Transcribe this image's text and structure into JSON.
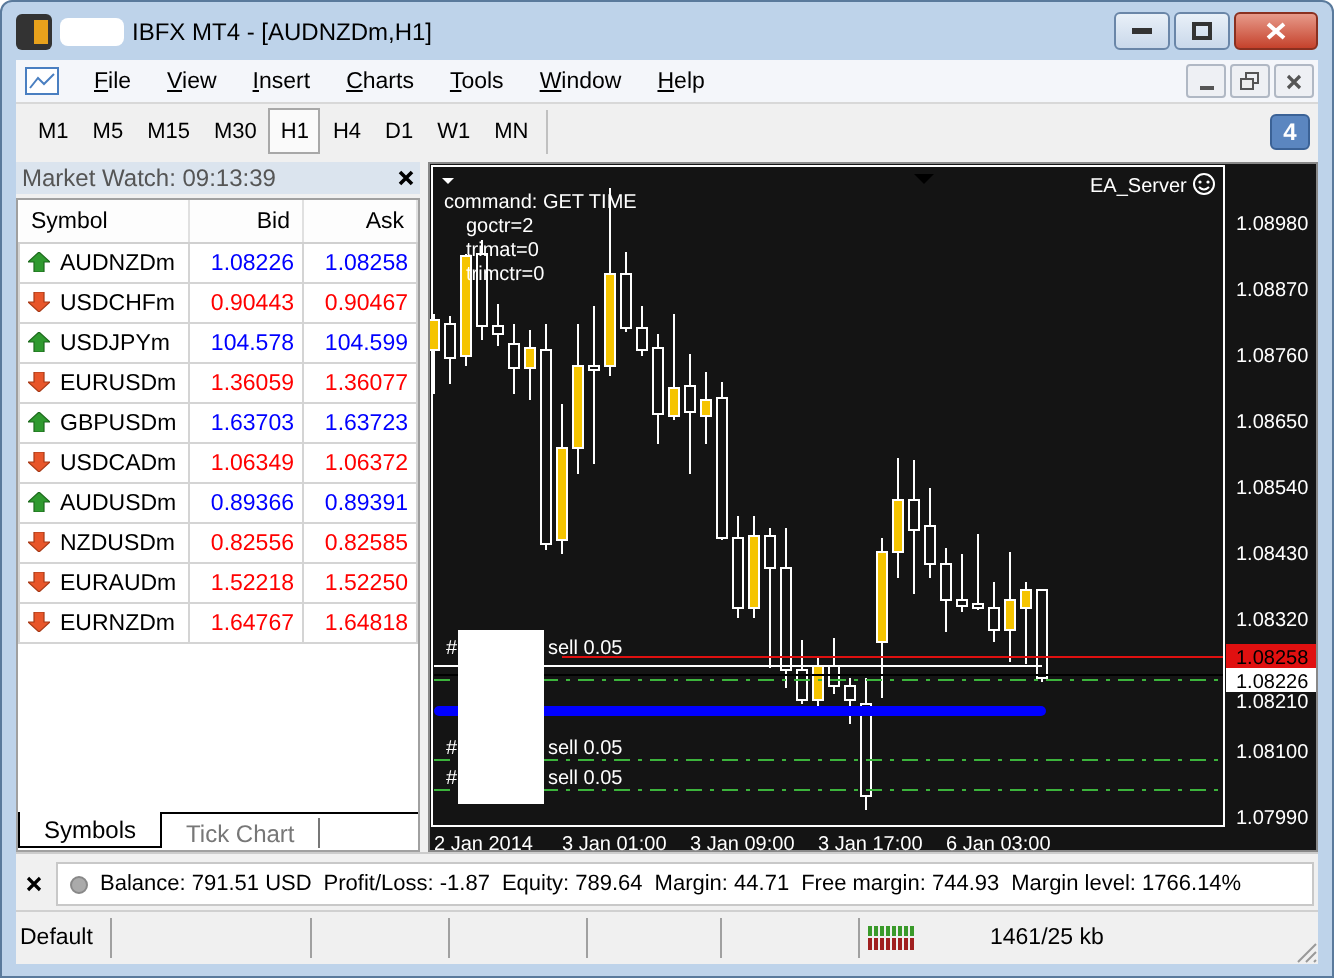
{
  "window": {
    "title": "IBFX MT4 - [AUDNZDm,H1]"
  },
  "menu": [
    "File",
    "View",
    "Insert",
    "Charts",
    "Tools",
    "Window",
    "Help"
  ],
  "timeframes": [
    {
      "label": "M1",
      "selected": false
    },
    {
      "label": "M5",
      "selected": false
    },
    {
      "label": "M15",
      "selected": false
    },
    {
      "label": "M30",
      "selected": false
    },
    {
      "label": "H1",
      "selected": true
    },
    {
      "label": "H4",
      "selected": false
    },
    {
      "label": "D1",
      "selected": false
    },
    {
      "label": "W1",
      "selected": false
    },
    {
      "label": "MN",
      "selected": false
    }
  ],
  "notifications": {
    "count": "4"
  },
  "market_watch": {
    "title": "Market Watch: 09:13:39",
    "columns": [
      "Symbol",
      "Bid",
      "Ask"
    ],
    "rows": [
      {
        "symbol": "AUDNZDm",
        "bid": "1.08226",
        "ask": "1.08258",
        "rising": true
      },
      {
        "symbol": "USDCHFm",
        "bid": "0.90443",
        "ask": "0.90467",
        "rising": false
      },
      {
        "symbol": "USDJPYm",
        "bid": "104.578",
        "ask": "104.599",
        "rising": true
      },
      {
        "symbol": "EURUSDm",
        "bid": "1.36059",
        "ask": "1.36077",
        "rising": false
      },
      {
        "symbol": "GBPUSDm",
        "bid": "1.63703",
        "ask": "1.63723",
        "rising": true
      },
      {
        "symbol": "USDCADm",
        "bid": "1.06349",
        "ask": "1.06372",
        "rising": false
      },
      {
        "symbol": "AUDUSDm",
        "bid": "0.89366",
        "ask": "0.89391",
        "rising": true
      },
      {
        "symbol": "NZDUSDm",
        "bid": "0.82556",
        "ask": "0.82585",
        "rising": false
      },
      {
        "symbol": "EURAUDm",
        "bid": "1.52218",
        "ask": "1.52250",
        "rising": false
      },
      {
        "symbol": "EURNZDm",
        "bid": "1.64767",
        "ask": "1.64818",
        "rising": false
      }
    ],
    "tabs": [
      {
        "label": "Symbols",
        "selected": true
      },
      {
        "label": "Tick Chart",
        "selected": false
      }
    ]
  },
  "chart": {
    "comment": [
      "command: GET TIME",
      "goctr=2",
      "trimat=0",
      "trimctr=0"
    ],
    "expert": "EA_Server",
    "orders": [
      {
        "prefix": "#",
        "label": "sell 0.05"
      },
      {
        "prefix": "#",
        "label": "sell 0.05"
      },
      {
        "prefix": "#",
        "label": "sell 0.05"
      }
    ],
    "price_ticks": [
      "1.08980",
      "1.08870",
      "1.08760",
      "1.08650",
      "1.08540",
      "1.08430",
      "1.08320",
      "1.08210",
      "1.08100",
      "1.07990"
    ],
    "ask_badge": "1.08258",
    "bid_badge": "1.08226",
    "time_ticks": [
      "2 Jan 2014",
      "3 Jan 01:00",
      "3 Jan 09:00",
      "3 Jan 17:00",
      "6 Jan 03:00"
    ]
  },
  "terminal": {
    "items": [
      "Balance: 791.51 USD",
      "Profit/Loss: -1.87",
      "Equity: 789.64",
      "Margin: 44.71",
      "Free margin: 744.93",
      "Margin level: 1766.14%"
    ]
  },
  "status_bar": {
    "profile": "Default",
    "traffic": "1461/25 kb"
  }
}
